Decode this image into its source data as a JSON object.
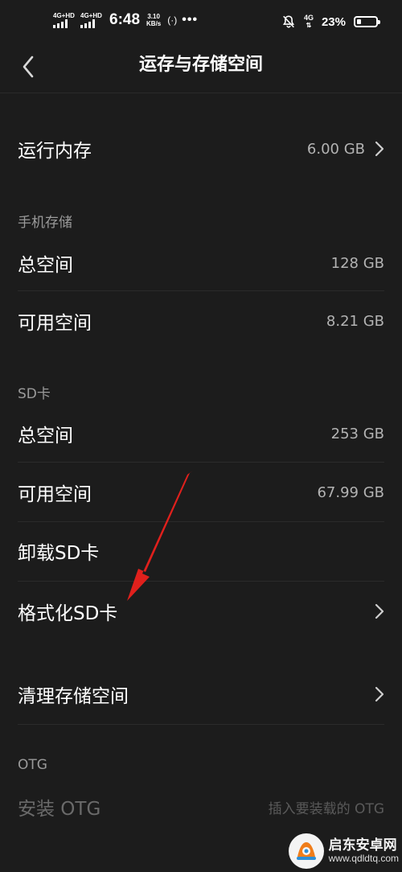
{
  "status_bar": {
    "sim1_label": "4G+HD",
    "sim2_label": "4G+HD",
    "time": "6:48",
    "speed_value": "3.10",
    "speed_unit": "KB/s",
    "hotspot": "(·)",
    "dots": "•••",
    "network": "4G",
    "battery_pct": "23%",
    "battery_level": 0.23
  },
  "header": {
    "title": "运存与存储空间"
  },
  "ram": {
    "label": "运行内存",
    "value": "6.00 GB"
  },
  "phone_storage": {
    "section": "手机存储",
    "total_label": "总空间",
    "total_value": "128 GB",
    "free_label": "可用空间",
    "free_value": "8.21 GB"
  },
  "sd_card": {
    "section": "SD卡",
    "total_label": "总空间",
    "total_value": "253 GB",
    "free_label": "可用空间",
    "free_value": "67.99 GB",
    "unmount_label": "卸载SD卡",
    "format_label": "格式化SD卡"
  },
  "cleanup": {
    "label": "清理存储空间"
  },
  "otg": {
    "section": "OTG",
    "install_label": "安装 OTG",
    "install_hint": "插入要装载的 OTG"
  },
  "watermark": {
    "title": "启东安卓网",
    "url": "www.qdldtq.com"
  },
  "colors": {
    "background": "#1c1c1c",
    "annotation_arrow": "#e0201c"
  }
}
